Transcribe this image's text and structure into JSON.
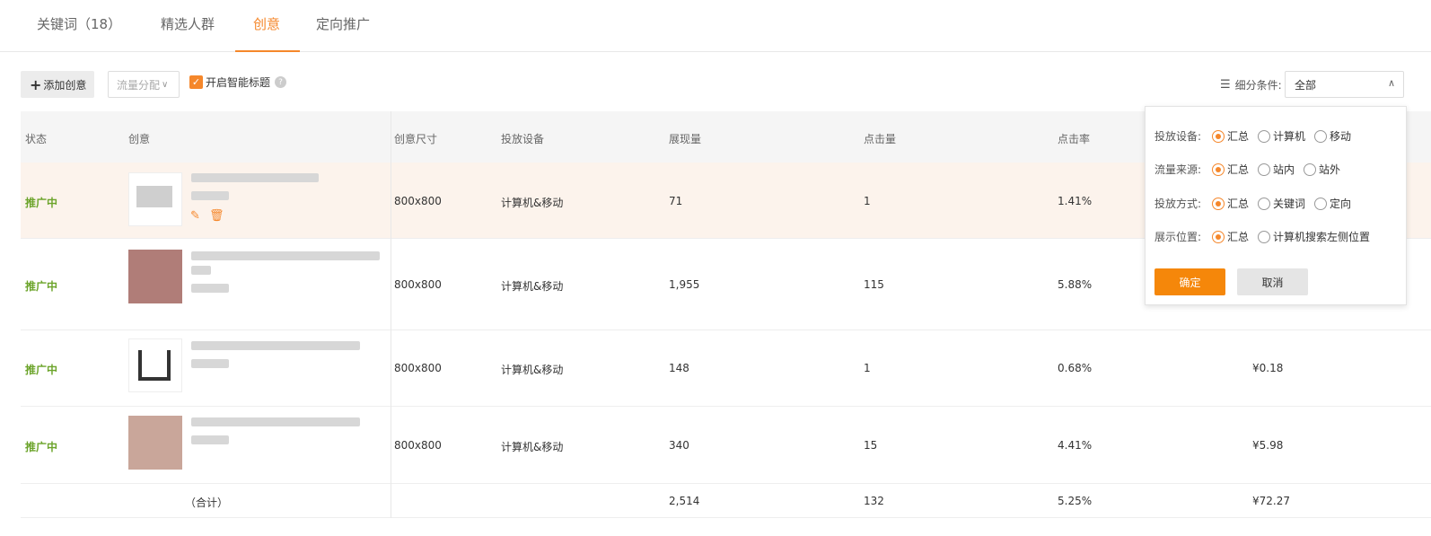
{
  "tabs": [
    {
      "label": "关键词（18）"
    },
    {
      "label": "精选人群"
    },
    {
      "label": "创意"
    },
    {
      "label": "定向推广"
    }
  ],
  "toolbar": {
    "add_label": "添加创意",
    "traffic_label": "流量分配",
    "smart_title_label": "开启智能标题",
    "filter_label": "细分条件:",
    "filter_value": "全部"
  },
  "table": {
    "headers": [
      "状态",
      "创意",
      "创意尺寸",
      "投放设备",
      "展现量",
      "点击量",
      "点击率"
    ],
    "rows": [
      {
        "status": "推广中",
        "size": "800x800",
        "device": "计算机&移动",
        "impressions": "71",
        "clicks": "1",
        "ctr": "1.41%",
        "cost": ""
      },
      {
        "status": "推广中",
        "size": "800x800",
        "device": "计算机&移动",
        "impressions": "1,955",
        "clicks": "115",
        "ctr": "5.88%",
        "cost": ""
      },
      {
        "status": "推广中",
        "size": "800x800",
        "device": "计算机&移动",
        "impressions": "148",
        "clicks": "1",
        "ctr": "0.68%",
        "cost": "¥0.18"
      },
      {
        "status": "推广中",
        "size": "800x800",
        "device": "计算机&移动",
        "impressions": "340",
        "clicks": "15",
        "ctr": "4.41%",
        "cost": "¥5.98"
      }
    ],
    "total": {
      "label": "（合计）",
      "impressions": "2,514",
      "clicks": "132",
      "ctr": "5.25%",
      "cost": "¥72.27"
    }
  },
  "popup": {
    "rows": [
      {
        "label": "投放设备:",
        "options": [
          "汇总",
          "计算机",
          "移动"
        ],
        "selected": 0
      },
      {
        "label": "流量来源:",
        "options": [
          "汇总",
          "站内",
          "站外"
        ],
        "selected": 0
      },
      {
        "label": "投放方式:",
        "options": [
          "汇总",
          "关键词",
          "定向"
        ],
        "selected": 0
      },
      {
        "label": "展示位置:",
        "options": [
          "汇总",
          "计算机搜索左侧位置"
        ],
        "selected": 0
      }
    ],
    "ok_label": "确定",
    "cancel_label": "取消"
  },
  "colors": {
    "accent": "#f5872b",
    "status_green": "#6ca42b",
    "highlight_row": "#fcf3ec"
  },
  "icons": {
    "add": "plus-icon",
    "edit": "pencil-icon",
    "delete": "trash-icon",
    "filter": "list-icon",
    "help": "question-icon"
  }
}
